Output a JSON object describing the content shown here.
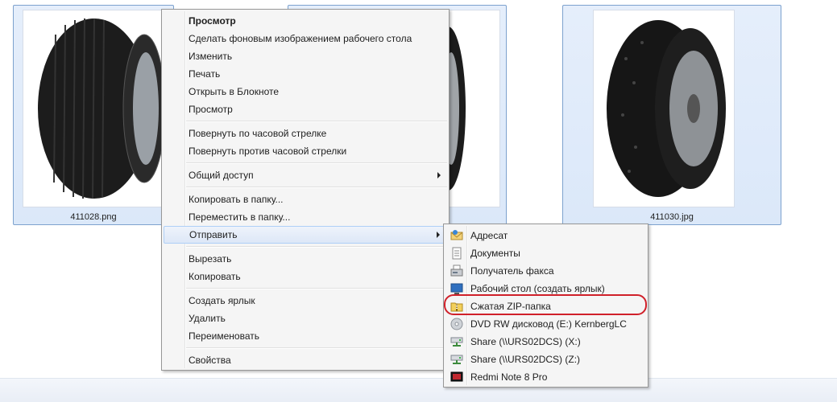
{
  "files": [
    {
      "name": "411028.png"
    },
    {
      "name": ""
    },
    {
      "name": "411030.jpg"
    }
  ],
  "context_menu": {
    "items": [
      {
        "label": "Просмотр"
      },
      {
        "label": "Сделать фоновым изображением рабочего стола"
      },
      {
        "label": "Изменить"
      },
      {
        "label": "Печать"
      },
      {
        "label": "Открыть в Блокноте"
      },
      {
        "label": "Просмотр"
      },
      {
        "label": "Повернуть по часовой стрелке"
      },
      {
        "label": "Повернуть против часовой стрелки"
      },
      {
        "label": "Общий доступ"
      },
      {
        "label": "Копировать в папку..."
      },
      {
        "label": "Переместить в папку..."
      },
      {
        "label": "Отправить"
      },
      {
        "label": "Вырезать"
      },
      {
        "label": "Копировать"
      },
      {
        "label": "Создать ярлык"
      },
      {
        "label": "Удалить"
      },
      {
        "label": "Переименовать"
      },
      {
        "label": "Свойства"
      }
    ]
  },
  "send_to_menu": {
    "items": [
      {
        "label": "Адресат",
        "icon": "mail-recipient-icon"
      },
      {
        "label": "Документы",
        "icon": "documents-icon"
      },
      {
        "label": "Получатель факса",
        "icon": "fax-icon"
      },
      {
        "label": "Рабочий стол (создать ярлык)",
        "icon": "desktop-icon"
      },
      {
        "label": "Сжатая ZIP-папка",
        "icon": "zip-folder-icon"
      },
      {
        "label": "DVD RW дисковод (E:) KernbergLC",
        "icon": "dvd-drive-icon"
      },
      {
        "label": "Share (\\\\URS02DCS) (X:)",
        "icon": "network-drive-icon"
      },
      {
        "label": "Share (\\\\URS02DCS) (Z:)",
        "icon": "network-drive-icon"
      },
      {
        "label": "Redmi Note 8 Pro",
        "icon": "phone-device-icon"
      }
    ]
  },
  "colors": {
    "highlight_ring": "#d0202a",
    "selection": "#dbe8f9"
  }
}
